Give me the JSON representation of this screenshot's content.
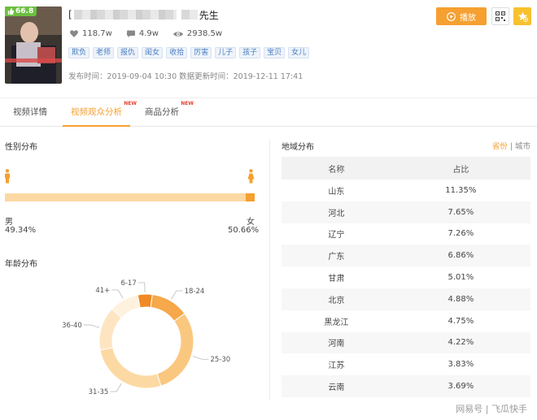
{
  "video": {
    "score": "66.8",
    "title_bracket": "[",
    "title_suffix": "先生",
    "likes": "118.7w",
    "comments": "4.9w",
    "views": "2938.5w",
    "tags": [
      "欺负",
      "老师",
      "报仇",
      "闺女",
      "收拾",
      "厉害",
      "儿子",
      "孩子",
      "宝贝",
      "女儿"
    ],
    "publish_time": "发布时间：2019-09-04 10:30 数据更新时间：2019-12-11 17:41",
    "play_label": "播放"
  },
  "tabs": [
    {
      "label": "视频详情",
      "new": ""
    },
    {
      "label": "视频观众分析",
      "new": "NEW"
    },
    {
      "label": "商品分析",
      "new": "NEW"
    }
  ],
  "gender": {
    "title": "性别分布",
    "male_label": "男",
    "male_pct": "49.34%",
    "female_label": "女",
    "female_pct": "50.66%",
    "female_fraction": 0.5066
  },
  "age": {
    "title": "年龄分布"
  },
  "chart_data": {
    "type": "pie",
    "title": "年龄分布",
    "categories": [
      "6-17",
      "18-24",
      "25-30",
      "31-35",
      "36-40",
      "41+"
    ],
    "values": [
      5,
      13,
      30,
      27,
      15,
      10
    ],
    "colors": [
      "#f08a24",
      "#f6a84a",
      "#fac77f",
      "#fcd9a3",
      "#fde5c2",
      "#fef1de"
    ]
  },
  "region": {
    "title": "地域分布",
    "toggle_province": "省份",
    "toggle_sep": "|",
    "toggle_city": "城市",
    "col_name": "名称",
    "col_share": "占比",
    "rows": [
      {
        "name": "山东",
        "share": "11.35%"
      },
      {
        "name": "河北",
        "share": "7.65%"
      },
      {
        "name": "辽宁",
        "share": "7.26%"
      },
      {
        "name": "广东",
        "share": "6.86%"
      },
      {
        "name": "甘肃",
        "share": "5.01%"
      },
      {
        "name": "北京",
        "share": "4.88%"
      },
      {
        "name": "黑龙江",
        "share": "4.75%"
      },
      {
        "name": "河南",
        "share": "4.22%"
      },
      {
        "name": "江苏",
        "share": "3.83%"
      },
      {
        "name": "云南",
        "share": "3.69%"
      }
    ]
  },
  "watermark": "网易号 | 飞瓜快手"
}
